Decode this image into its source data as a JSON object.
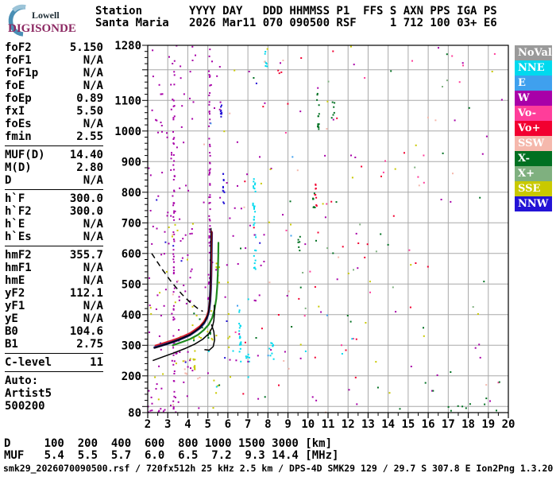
{
  "logo": {
    "line1": "Lowell",
    "line2": "DIGISONDE"
  },
  "header": {
    "line1": "Station       YYYY DAY   DDD HHMMSS P1  FFS S AXN PPS IGA PS",
    "line2": "Santa Maria   2026 Mar11 070 090500 RSF     1 712 100 03+ E6"
  },
  "params": {
    "sections": [
      [
        [
          "foF2",
          "5.150"
        ],
        [
          "foF1",
          "N/A"
        ],
        [
          "foF1p",
          "N/A"
        ],
        [
          "foE",
          "N/A"
        ],
        [
          "foEp",
          "0.89"
        ],
        [
          "fxI",
          "5.50"
        ],
        [
          "foEs",
          "N/A"
        ],
        [
          "fmin",
          "2.55"
        ]
      ],
      [
        [
          "MUF(D)",
          "14.40"
        ],
        [
          "M(D)",
          "2.80"
        ],
        [
          "D",
          "N/A"
        ]
      ],
      [
        [
          "h`F",
          "300.0"
        ],
        [
          "h`F2",
          "300.0"
        ],
        [
          "h`E",
          "N/A"
        ],
        [
          "h`Es",
          "N/A"
        ]
      ],
      [
        [
          "hmF2",
          "355.7"
        ],
        [
          "hmF1",
          "N/A"
        ],
        [
          "hmE",
          "N/A"
        ],
        [
          "yF2",
          "112.1"
        ],
        [
          "yF1",
          "N/A"
        ],
        [
          "yE",
          "N/A"
        ],
        [
          "B0",
          "104.6"
        ],
        [
          "B1",
          "2.75"
        ]
      ],
      [
        [
          "C-level",
          "11"
        ]
      ]
    ],
    "footer": [
      "Auto:",
      "Artist5",
      "500200"
    ]
  },
  "legend": [
    {
      "label": "NoVal",
      "color": "#9a9a9a"
    },
    {
      "label": "NNE",
      "color": "#00d9ee"
    },
    {
      "label": "E",
      "color": "#3fa0ee"
    },
    {
      "label": "W",
      "color": "#a800a8"
    },
    {
      "label": "Vo-",
      "color": "#ff3d9a"
    },
    {
      "label": "Vo+",
      "color": "#f20030"
    },
    {
      "label": "SSW",
      "color": "#f5b8ac"
    },
    {
      "label": "X-",
      "color": "#007021"
    },
    {
      "label": "X+",
      "color": "#7fb07f"
    },
    {
      "label": "SSE",
      "color": "#c9c900"
    },
    {
      "label": "NNW",
      "color": "#2313d6"
    }
  ],
  "bottom": {
    "d_line": "D     100  200  400  600  800 1000 1500 3000 [km]",
    "muf_line": "MUF   5.4  5.5  5.7  6.0  6.5  7.2  9.3 14.4 [MHz]",
    "ranges_km": [
      100,
      200,
      400,
      600,
      800,
      1000,
      1500,
      3000
    ],
    "muf_mhz": [
      5.4,
      5.5,
      5.7,
      6.0,
      6.5,
      7.2,
      9.3,
      14.4
    ],
    "status_line": "smk29_2026070090500.rsf / 720fx512h 25 kHz 2.5 km / DPS-4D SMK29 129 / 29.7 S 307.8 E Ion2Png 1.3.20"
  },
  "chart_data": {
    "type": "scatter",
    "title": "Digisonde ionogram, Santa Maria, 2026 Mar11 070 090500",
    "xlabel": "[MHz]",
    "ylabel": "[km]",
    "xlim": [
      2,
      20
    ],
    "ylim": [
      80,
      1280
    ],
    "x_ticks": [
      2,
      3,
      4,
      5,
      6,
      7,
      8,
      9,
      10,
      11,
      12,
      13,
      14,
      15,
      16,
      17,
      18,
      19,
      20
    ],
    "y_tick_labels": [
      1280,
      1100,
      1000,
      900,
      800,
      700,
      600,
      500,
      400,
      300,
      200,
      80
    ],
    "grid": true,
    "grid_color": "#a8a8a8",
    "colors": {
      "NoVal": "#9a9a9a",
      "NNE": "#00d9ee",
      "E": "#3fa0ee",
      "W": "#a800a8",
      "Vo-": "#ff3d9a",
      "Vo+": "#f20030",
      "SSW": "#f5b8ac",
      "X-": "#007021",
      "X+": "#7fb07f",
      "SSE": "#c9c900",
      "NNW": "#2313d6",
      "o_inner": "#d81f2a",
      "o_outer": "#1b1b6e",
      "x_trace": "#1e8a1e",
      "model": "#000000"
    },
    "o_trace": [
      [
        2.35,
        293
      ],
      [
        2.6,
        298
      ],
      [
        2.9,
        304
      ],
      [
        3.2,
        310
      ],
      [
        3.5,
        317
      ],
      [
        3.8,
        325
      ],
      [
        4.1,
        334
      ],
      [
        4.35,
        345
      ],
      [
        4.6,
        357
      ],
      [
        4.8,
        372
      ],
      [
        4.95,
        390
      ],
      [
        5.05,
        412
      ],
      [
        5.11,
        445
      ],
      [
        5.14,
        485
      ],
      [
        5.16,
        530
      ],
      [
        5.17,
        575
      ],
      [
        5.18,
        625
      ],
      [
        5.19,
        668
      ]
    ],
    "x_trace": [
      [
        3.25,
        300
      ],
      [
        3.7,
        310
      ],
      [
        4.1,
        320
      ],
      [
        4.5,
        334
      ],
      [
        4.8,
        350
      ],
      [
        5.05,
        368
      ],
      [
        5.22,
        390
      ],
      [
        5.34,
        418
      ],
      [
        5.42,
        452
      ],
      [
        5.47,
        492
      ],
      [
        5.5,
        540
      ],
      [
        5.52,
        592
      ],
      [
        5.53,
        635
      ]
    ],
    "fit_trace": [
      [
        2.3,
        290
      ],
      [
        2.9,
        303
      ],
      [
        3.5,
        317
      ],
      [
        4.1,
        334
      ],
      [
        4.55,
        355
      ],
      [
        4.85,
        378
      ],
      [
        5.0,
        400
      ],
      [
        5.08,
        430
      ],
      [
        5.12,
        470
      ],
      [
        5.14,
        520
      ],
      [
        5.15,
        575
      ],
      [
        5.16,
        630
      ],
      [
        5.16,
        683
      ]
    ],
    "profile": [
      [
        2.25,
        250
      ],
      [
        2.75,
        262
      ],
      [
        3.3,
        275
      ],
      [
        3.85,
        289
      ],
      [
        4.35,
        304
      ],
      [
        4.75,
        320
      ],
      [
        5.05,
        338
      ],
      [
        5.22,
        358
      ],
      [
        5.3,
        380
      ],
      [
        5.33,
        405
      ],
      [
        5.32,
        432
      ]
    ],
    "profile_hook": [
      [
        5.18,
        368
      ],
      [
        5.3,
        345
      ],
      [
        5.34,
        318
      ],
      [
        5.27,
        296
      ],
      [
        5.07,
        284
      ],
      [
        4.83,
        286
      ]
    ],
    "transmission_dashed": [
      [
        2.2,
        600
      ],
      [
        2.7,
        550
      ],
      [
        3.2,
        505
      ],
      [
        3.7,
        467
      ],
      [
        4.15,
        438
      ],
      [
        4.5,
        420
      ],
      [
        4.75,
        411
      ]
    ],
    "noise_seed": 1337,
    "noise_clusters": [
      {
        "c": "W",
        "x": [
          3.27,
          3.35
        ],
        "k": [
          80,
          1280
        ],
        "n": 70
      },
      {
        "c": "W",
        "x": [
          5.05,
          5.12
        ],
        "k": [
          640,
          1280
        ],
        "n": 48
      },
      {
        "c": "W",
        "x": [
          5.02,
          5.15
        ],
        "k": [
          430,
          640
        ],
        "n": 12
      },
      {
        "c": "NNW",
        "x": [
          5.64,
          5.72
        ],
        "k": [
          1030,
          1090
        ],
        "n": 8
      },
      {
        "c": "NNW",
        "x": [
          5.74,
          5.84
        ],
        "k": [
          750,
          860
        ],
        "n": 11
      },
      {
        "c": "NNE",
        "x": [
          7.25,
          7.38
        ],
        "k": [
          690,
          845
        ],
        "n": 22
      },
      {
        "c": "NNE",
        "x": [
          7.28,
          7.45
        ],
        "k": [
          545,
          680
        ],
        "n": 10
      },
      {
        "c": "NNE",
        "x": [
          6.56,
          6.66
        ],
        "k": [
          245,
          425
        ],
        "n": 18
      },
      {
        "c": "NNE",
        "x": [
          8.05,
          8.3
        ],
        "k": [
          250,
          310
        ],
        "n": 9
      },
      {
        "c": "NNE",
        "x": [
          6.9,
          7.1
        ],
        "k": [
          195,
          265
        ],
        "n": 6
      },
      {
        "c": "NNE",
        "x": [
          7.85,
          7.98
        ],
        "k": [
          1210,
          1280
        ],
        "n": 7
      },
      {
        "c": "X-",
        "x": [
          10.42,
          10.56
        ],
        "k": [
          1000,
          1125
        ],
        "n": 14
      },
      {
        "c": "X-",
        "x": [
          11.18,
          11.32
        ],
        "k": [
          1040,
          1105
        ],
        "n": 6
      },
      {
        "c": "X-",
        "x": [
          10.24,
          10.36
        ],
        "k": [
          745,
          800
        ],
        "n": 7
      },
      {
        "c": "X-",
        "x": [
          9.5,
          9.62
        ],
        "k": [
          590,
          660
        ],
        "n": 6
      },
      {
        "c": "Vo+",
        "x": [
          10.33,
          10.45
        ],
        "k": [
          750,
          850
        ],
        "n": 9
      },
      {
        "c": "SSE",
        "x": [
          4.26,
          4.36
        ],
        "k": [
          215,
          295
        ],
        "n": 9
      },
      {
        "c": "SSE",
        "x": [
          5.42,
          5.58
        ],
        "k": [
          480,
          570
        ],
        "n": 6
      },
      {
        "c": "SSW",
        "x": [
          3.84,
          3.95
        ],
        "k": [
          195,
          255
        ],
        "n": 7
      },
      {
        "c": "W",
        "x": [
          2.05,
          4.3
        ],
        "k": [
          80,
          1280
        ],
        "n": 120
      },
      {
        "c": "W",
        "x": [
          4.3,
          8.0
        ],
        "k": [
          80,
          1280
        ],
        "n": 45
      },
      {
        "c": "W",
        "x": [
          8.0,
          19.9
        ],
        "k": [
          80,
          1280
        ],
        "n": 40
      },
      {
        "c": "W",
        "x": [
          2.0,
          3.6
        ],
        "k": [
          80,
          100
        ],
        "n": 10
      },
      {
        "c": "SSE",
        "x": [
          2.1,
          6.5
        ],
        "k": [
          80,
          700
        ],
        "n": 30
      },
      {
        "c": "SSE",
        "x": [
          5.0,
          19.5
        ],
        "k": [
          80,
          1280
        ],
        "n": 25
      },
      {
        "c": "Vo+",
        "x": [
          6.5,
          16.0
        ],
        "k": [
          80,
          950
        ],
        "n": 26
      },
      {
        "c": "Vo+",
        "x": [
          7.0,
          14.0
        ],
        "k": [
          1000,
          1280
        ],
        "n": 8
      },
      {
        "c": "Vo-",
        "x": [
          6.0,
          19.8
        ],
        "k": [
          80,
          1260
        ],
        "n": 22
      },
      {
        "c": "X-",
        "x": [
          5.5,
          19.8
        ],
        "k": [
          80,
          1280
        ],
        "n": 30
      },
      {
        "c": "X-",
        "x": [
          17.0,
          19.6
        ],
        "k": [
          82,
          130
        ],
        "n": 7
      },
      {
        "c": "X+",
        "x": [
          6.0,
          19.5
        ],
        "k": [
          150,
          1200
        ],
        "n": 12
      },
      {
        "c": "SSW",
        "x": [
          2.2,
          19.5
        ],
        "k": [
          80,
          1250
        ],
        "n": 24
      },
      {
        "c": "NNW",
        "x": [
          2.4,
          8.0
        ],
        "k": [
          200,
          1250
        ],
        "n": 10
      },
      {
        "c": "E",
        "x": [
          4.5,
          14.0
        ],
        "k": [
          200,
          1100
        ],
        "n": 6
      },
      {
        "c": "NNE",
        "x": [
          4.0,
          13.5
        ],
        "k": [
          90,
          500
        ],
        "n": 8
      },
      {
        "c": "SSE",
        "x": [
          4.2,
          5.6
        ],
        "k": [
          300,
          430
        ],
        "n": 10
      },
      {
        "c": "X-",
        "x": [
          4.3,
          5.5
        ],
        "k": [
          310,
          420
        ],
        "n": 8
      }
    ]
  }
}
